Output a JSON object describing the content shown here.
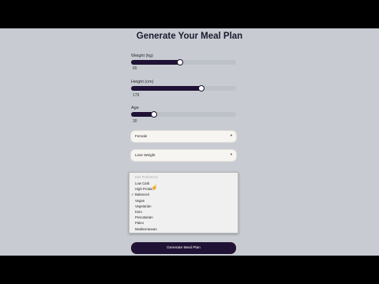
{
  "page": {
    "title": "Generate Your Meal Plan"
  },
  "weight": {
    "label": "Weight (kg)",
    "value": "65",
    "level": 0.46
  },
  "height": {
    "label": "Height (cm)",
    "value": "179",
    "level": 0.66
  },
  "age": {
    "label": "Age",
    "value": "30",
    "level": 0.21
  },
  "gender": {
    "selected": "Female",
    "caret": "▾"
  },
  "goal": {
    "selected": "Lose Weight",
    "caret": "▾"
  },
  "diet": {
    "header": "Diet Preference",
    "selected": "Balanced",
    "options": [
      "Low Carb",
      "High Protein",
      "Balanced",
      "Vegan",
      "Vegetarian",
      "Keto",
      "Pescatarian",
      "Paleo",
      "Mediterranean"
    ]
  },
  "submit": {
    "label": "Generate Meal Plan"
  },
  "colors": {
    "accent": "#1f1235",
    "background": "#c8ccd2"
  },
  "icons": {
    "check": "checkmark-icon",
    "caret": "chevron-down-icon",
    "cursor": "hand-pointer-icon"
  }
}
